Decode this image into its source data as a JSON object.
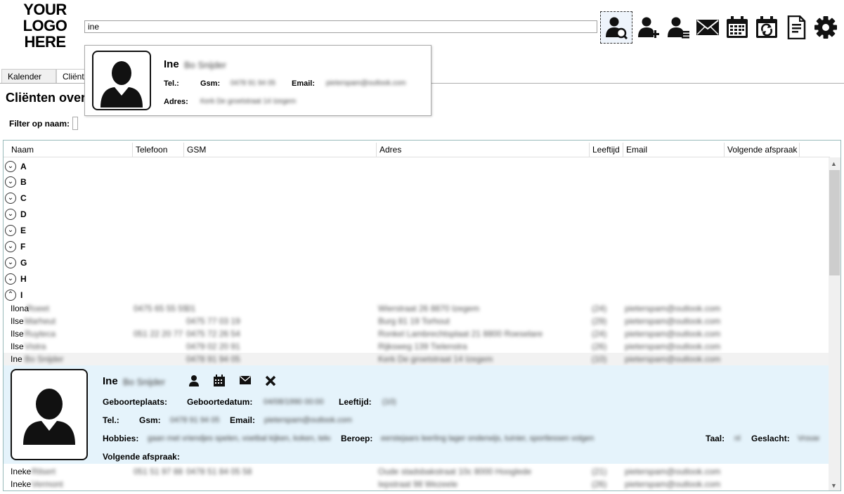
{
  "logo": {
    "line1": "YOUR",
    "line2": "LOGO",
    "line3": "HERE"
  },
  "search": {
    "value": "ine"
  },
  "toolbar": [
    {
      "name": "search-client-icon"
    },
    {
      "name": "add-client-icon"
    },
    {
      "name": "client-list-icon"
    },
    {
      "name": "mail-icon"
    },
    {
      "name": "calendar-icon"
    },
    {
      "name": "calendar-sync-icon"
    },
    {
      "name": "document-icon"
    },
    {
      "name": "gear-icon"
    }
  ],
  "tabs": [
    "Kalender",
    "Cliënten"
  ],
  "page": {
    "title": "Cliënten overzicht",
    "filter_label": "Filter op naam:"
  },
  "popup": {
    "first_name": "Ine",
    "last_name": "Bo Snijder",
    "tel_label": "Tel.:",
    "gsm_label": "Gsm:",
    "gsm_value": "0478 91 94 05",
    "email_label": "Email:",
    "email_value": "pieterspam@outlook.com",
    "adres_label": "Adres:",
    "adres_value": "Kerk De groetstraat 14 Izegem"
  },
  "table": {
    "columns": [
      "Naam",
      "Telefoon",
      "GSM",
      "Adres",
      "Leeftijd",
      "Email",
      "Volgende afspraak"
    ],
    "groups": [
      "A",
      "B",
      "C",
      "D",
      "E",
      "F",
      "G",
      "H",
      "I"
    ],
    "rows": [
      {
        "first": "Ilona",
        "last": "Roeet",
        "tel": "0475 65 55 55",
        "gsm": "01",
        "adres": "Wierstraat 26 8870 Izegem",
        "age": "(24)",
        "email": "pieterspam@outlook.com"
      },
      {
        "first": "Ilse",
        "last": "Marheut",
        "tel": "",
        "gsm": "0475 77 03 19",
        "adres": "Burg 81 19 Torhout",
        "age": "(29)",
        "email": "pieterspam@outlook.com"
      },
      {
        "first": "Ilse",
        "last": "Ruyteca",
        "tel": "051 22 20 77",
        "gsm": "0475 72 26 54",
        "adres": "Ronkel Lambrechtsplaat 21 8800 Roeselare",
        "age": "(24)",
        "email": "pieterspam@outlook.com"
      },
      {
        "first": "Ilse",
        "last": "Vistra",
        "tel": "",
        "gsm": "0479 02 20 91",
        "adres": "Rijksweg 139 Tielenstra",
        "age": "(26)",
        "email": "pieterspam@outlook.com"
      },
      {
        "first": "Ine",
        "last": "Bo Snijder",
        "tel": "",
        "gsm": "0478 91 94 05",
        "adres": "Kerk De groetstraat 14 Izegem",
        "age": "(10)",
        "email": "pieterspam@outlook.com"
      },
      {
        "first": "Ineke",
        "last": "Rilsert",
        "tel": "051 51 97 88",
        "gsm": "0478 51 84 05 58",
        "adres": "Oude stadsbakstraat 10c 8000 Hooglede",
        "age": "(21)",
        "email": "pieterspam@outlook.com"
      },
      {
        "first": "Ineke",
        "last": "Vermont",
        "tel": "",
        "gsm": "",
        "adres": "Iepstraat 98 Wezeele",
        "age": "(26)",
        "email": "pieterspam@outlook.com"
      }
    ]
  },
  "detail": {
    "first_name": "Ine",
    "last_name": "Bo Snijder",
    "geboorteplaats_label": "Geboorteplaats:",
    "geboortedatum_label": "Geboortedatum:",
    "geboortedatum_value": "04/08/1990 00:00",
    "leeftijd_label": "Leeftijd:",
    "leeftijd_value": "(10)",
    "tel_label": "Tel.:",
    "gsm_label": "Gsm:",
    "gsm_value": "0478 91 94 05",
    "email_label": "Email:",
    "email_value": "pieterspam@outlook.com",
    "hobbies_label": "Hobbies:",
    "hobbies_value": "gaan met vriendjes spelen, voetbal kijken, koken, tekenen",
    "beroep_label": "Beroep:",
    "beroep_value": "eerstejaars leerling lager onderwijs, tuinier, sportlessen volgen",
    "taal_label": "Taal:",
    "taal_value": "nl",
    "geslacht_label": "Geslacht:",
    "geslacht_value": "Vrouw",
    "afspraak_label": "Volgende afspraak:"
  }
}
